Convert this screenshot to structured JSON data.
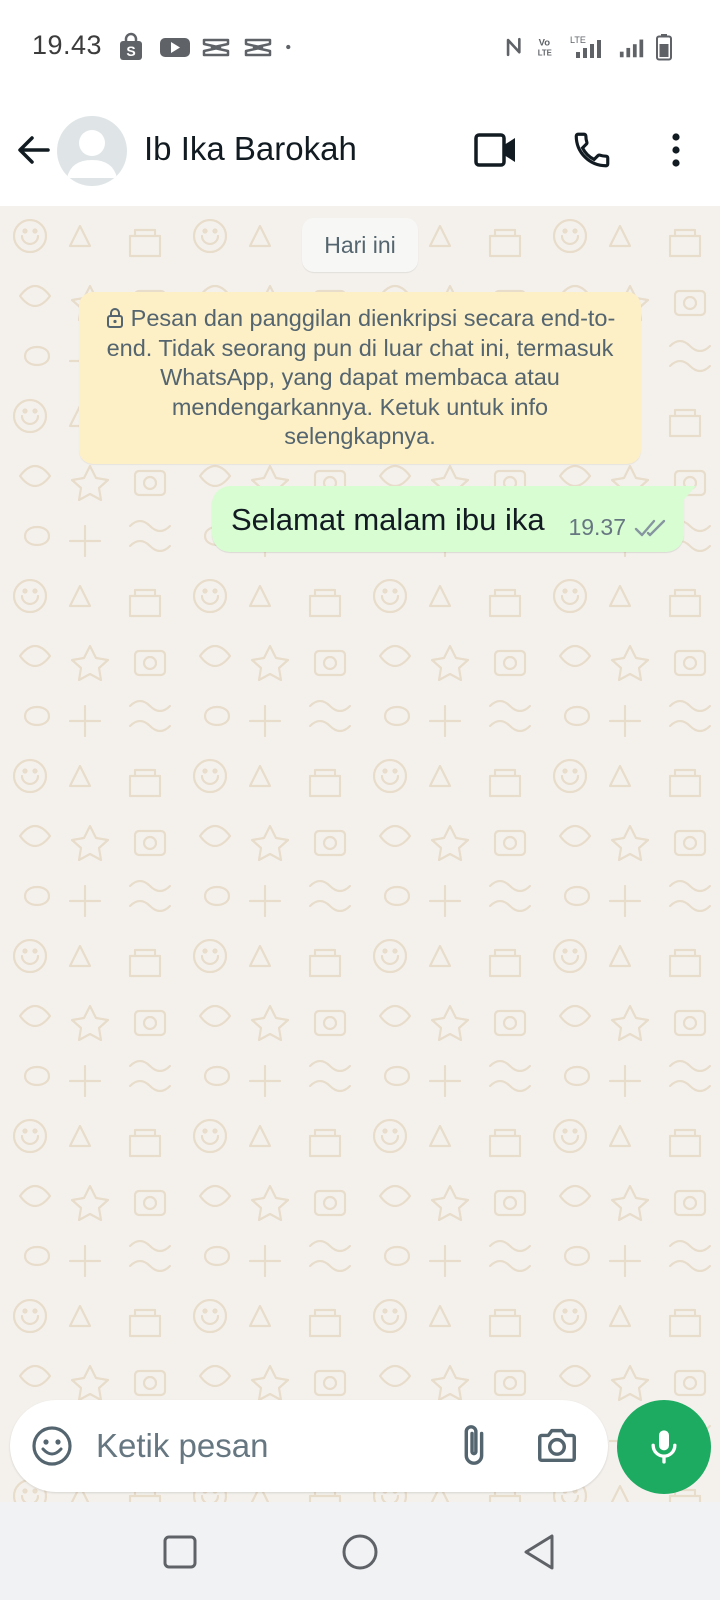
{
  "status_bar": {
    "time": "19.43",
    "left_icons": [
      "shopping-bag-icon",
      "youtube-icon",
      "capcut-icon",
      "capcut-icon",
      "dot-icon"
    ],
    "right_icons": [
      "nfc-icon",
      "volte-icon",
      "lte-signal-icon",
      "signal-icon",
      "battery-icon"
    ]
  },
  "header": {
    "contact_name": "Ib Ika Barokah",
    "back_icon": "arrow-left-icon",
    "video_icon": "video-camera-icon",
    "call_icon": "phone-icon",
    "menu_icon": "more-vertical-icon"
  },
  "chat": {
    "date_label": "Hari ini",
    "encryption_notice": "Pesan dan panggilan dienkripsi secara end-to-end. Tidak seorang pun di luar chat ini, termasuk WhatsApp, yang dapat membaca atau mendengarkannya. Ketuk untuk info selengkapnya.",
    "messages": [
      {
        "direction": "outgoing",
        "text": "Selamat malam ibu ika",
        "time": "19.37",
        "status": "delivered"
      }
    ]
  },
  "composer": {
    "placeholder": "Ketik pesan",
    "value": ""
  },
  "colors": {
    "accent": "#1daa61",
    "outgoing_bubble": "#d9fdd3",
    "notice_bg": "#fdefc6",
    "wallpaper": "#f4f1ec"
  }
}
